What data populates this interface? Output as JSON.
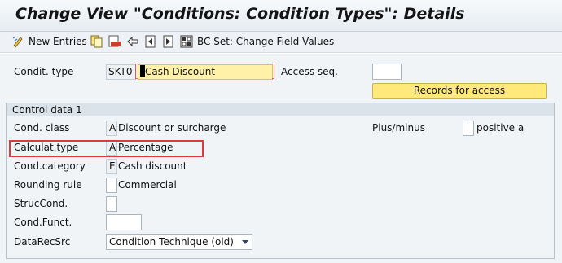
{
  "window": {
    "title": "Change View \"Conditions: Condition Types\": Details"
  },
  "toolbar": {
    "new_entries_label": "New Entries",
    "bc_set_label": "BC Set: Change Field Values",
    "icons": [
      "new-entries-icon",
      "copy-icon",
      "delete-icon",
      "undo-icon",
      "previous-entry-icon",
      "next-entry-icon",
      "bc-set-icon"
    ]
  },
  "header": {
    "condition_type_label": "Condit. type",
    "condition_type_value": "SKT0",
    "condition_type_name": "Cash Discount",
    "access_seq_label": "Access seq.",
    "access_seq_value": "",
    "records_button": "Records for access"
  },
  "control_data": {
    "group_title": "Control data 1",
    "cond_class_label": "Cond. class",
    "cond_class_code": "A",
    "cond_class_text": "Discount or surcharge",
    "calc_type_label": "Calculat.type",
    "calc_type_code": "A",
    "calc_type_text": "Percentage",
    "cond_category_label": "Cond.category",
    "cond_category_code": "E",
    "cond_category_text": "Cash discount",
    "rounding_label": "Rounding rule",
    "rounding_code": "",
    "rounding_text": "Commercial",
    "struc_cond_label": "StrucCond.",
    "struc_cond_value": "",
    "cond_funct_label": "Cond.Funct.",
    "cond_funct_value": "",
    "data_rec_src_label": "DataRecSrc",
    "data_rec_src_value": "Condition Technique (old)",
    "plus_minus_label": "Plus/minus",
    "plus_minus_code": "",
    "plus_minus_text": "positive a"
  },
  "colors": {
    "highlight_field": "#fff2a8",
    "button": "#ffe97a",
    "red_outline": "#e0383d",
    "background": "#f1f4f7"
  }
}
